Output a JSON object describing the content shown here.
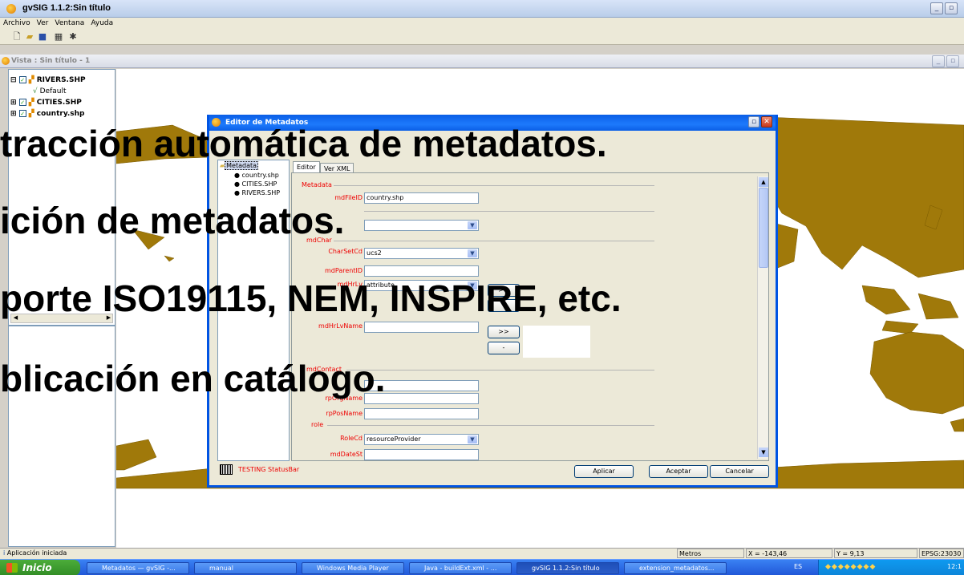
{
  "window": {
    "title": "gvSIG 1.1.2:Sin título"
  },
  "menu": [
    "Archivo",
    "Ver",
    "Ventana",
    "Ayuda"
  ],
  "view": {
    "title": "Vista : Sin título - 1"
  },
  "toc": {
    "layers": [
      {
        "name": "RIVERS.SHP",
        "checked": true
      },
      {
        "name": "CITIES.SHP",
        "checked": true
      },
      {
        "name": "country.shp",
        "checked": true
      }
    ],
    "legend_default": "Default"
  },
  "dialog": {
    "title": "Editor de Metadatos",
    "tree_root": "Metadata",
    "tree_items": [
      "country.shp",
      "CITIES.SHP",
      "RIVERS.SHP"
    ],
    "tabs": [
      "Editor",
      "Ver XML"
    ],
    "form": {
      "sec_metadata": "Metadata",
      "mdFileID_label": "mdFileID",
      "mdFileID_value": "country.shp",
      "sec_mdChar": "mdChar",
      "CharSetCd_label": "CharSetCd",
      "CharSetCd_value": "ucs2",
      "mdParentID_label": "mdParentID",
      "mdHrLv_label": "mdHrLv",
      "mdHrLv_value": "attribute",
      "mdHrLvName_label": "mdHrLvName",
      "add_btn": ">>",
      "remove_btn": "-",
      "sec_mdContact": "mdContact",
      "rpOrgName_label": "rpOrgName",
      "rpPosName_label": "rpPosName",
      "sec_role": "role",
      "RoleCd_label": "RoleCd",
      "RoleCd_value": "resourceProvider",
      "mdDateSt_label": "mdDateSt"
    },
    "status": "TESTING StatusBar",
    "buttons": {
      "apply": "Aplicar",
      "accept": "Aceptar",
      "cancel": "Cancelar"
    }
  },
  "overlay_text": [
    "tracción automática de metadatos.",
    "ición de metadatos.",
    "porte ISO19115, NEM, INSPIRE, etc.",
    "blicación en catálogo."
  ],
  "statusbar": {
    "left": "Aplicación iniciada",
    "units": "Metros",
    "x": "X = -143,46",
    "y": "Y = 9,13",
    "epsg": "EPSG:23030"
  },
  "taskbar": {
    "start": "Inicio",
    "items": [
      "Metadatos — gvSIG -...",
      "manual",
      "Windows Media Player",
      "Java - buildExt.xml - ...",
      "gvSIG 1.1.2:Sin título",
      "extension_metadatos..."
    ],
    "lang": "ES",
    "clock": "12:1"
  },
  "colors": {
    "land": "#a0790a",
    "title_blue": "#0054e3"
  }
}
